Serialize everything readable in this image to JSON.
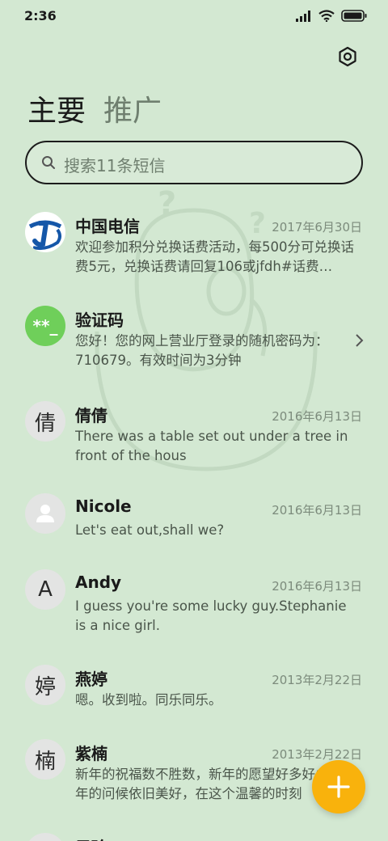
{
  "status": {
    "time": "2:36"
  },
  "tabs": {
    "primary": "主要",
    "promotions": "推广"
  },
  "search": {
    "placeholder": "搜索11条短信"
  },
  "conversations": [
    {
      "name": "中国电信",
      "date": "2017年6月30日",
      "preview": "欢迎参加积分兑换话费活动，每500分可兑换话费5元，兑换话费请回复106或jfdh#话费…",
      "avatar": "telecom-logo"
    },
    {
      "name": "验证码",
      "date": "",
      "preview": "您好！您的网上营业厅登录的随机密码为：710679。有效时间为3分钟",
      "avatar_text": "**_"
    },
    {
      "name": "倩倩",
      "date": "2016年6月13日",
      "preview": "There was a table set out under a tree in front of the hous",
      "avatar_text": "倩"
    },
    {
      "name": "Nicole",
      "date": "2016年6月13日",
      "preview": "Let's eat out,shall we?",
      "avatar": "person-icon"
    },
    {
      "name": "Andy",
      "date": "2016年6月13日",
      "preview": "I guess you're some lucky guy.Stephanie is a nice girl.",
      "avatar_text": "A"
    },
    {
      "name": "燕婷",
      "date": "2013年2月22日",
      "preview": "嗯。收到啦。同乐同乐。",
      "avatar_text": "婷"
    },
    {
      "name": "紫楠",
      "date": "2013年2月22日",
      "preview": "新年的祝福数不胜数，新年的愿望好多好多，新年的问候依旧美好，在这个温馨的时刻",
      "avatar_text": "楠"
    },
    {
      "name": "子玲",
      "date": "",
      "preview": "",
      "avatar_text": "玲"
    }
  ],
  "colors": {
    "background": "#d3e8d2",
    "fab": "#f9b20c",
    "verification_avatar": "#6fcf5a",
    "telecom_blue": "#1557a8"
  }
}
